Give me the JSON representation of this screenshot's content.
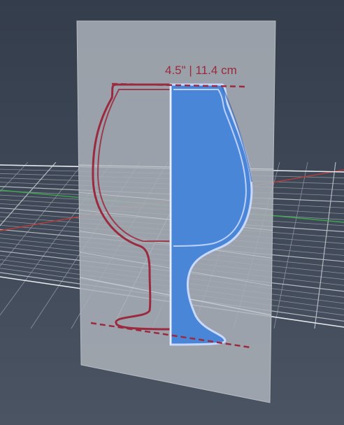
{
  "viewport": {
    "background_top": "#343d4b",
    "background_bottom": "#46505e"
  },
  "grid": {
    "line_color": "#c8ccd2",
    "x_axis_color": "#c23a3a",
    "y_axis_color": "#3fae4e"
  },
  "sketch_plane": {
    "color": "#a9aeb6"
  },
  "profile": {
    "outline_color": "#9b2a3e",
    "fill_color": "#4a86d8",
    "highlight_color": "#c9d8ff"
  },
  "dimension": {
    "label": "4.5\" | 11.4 cm",
    "color": "#9b2a3e"
  }
}
